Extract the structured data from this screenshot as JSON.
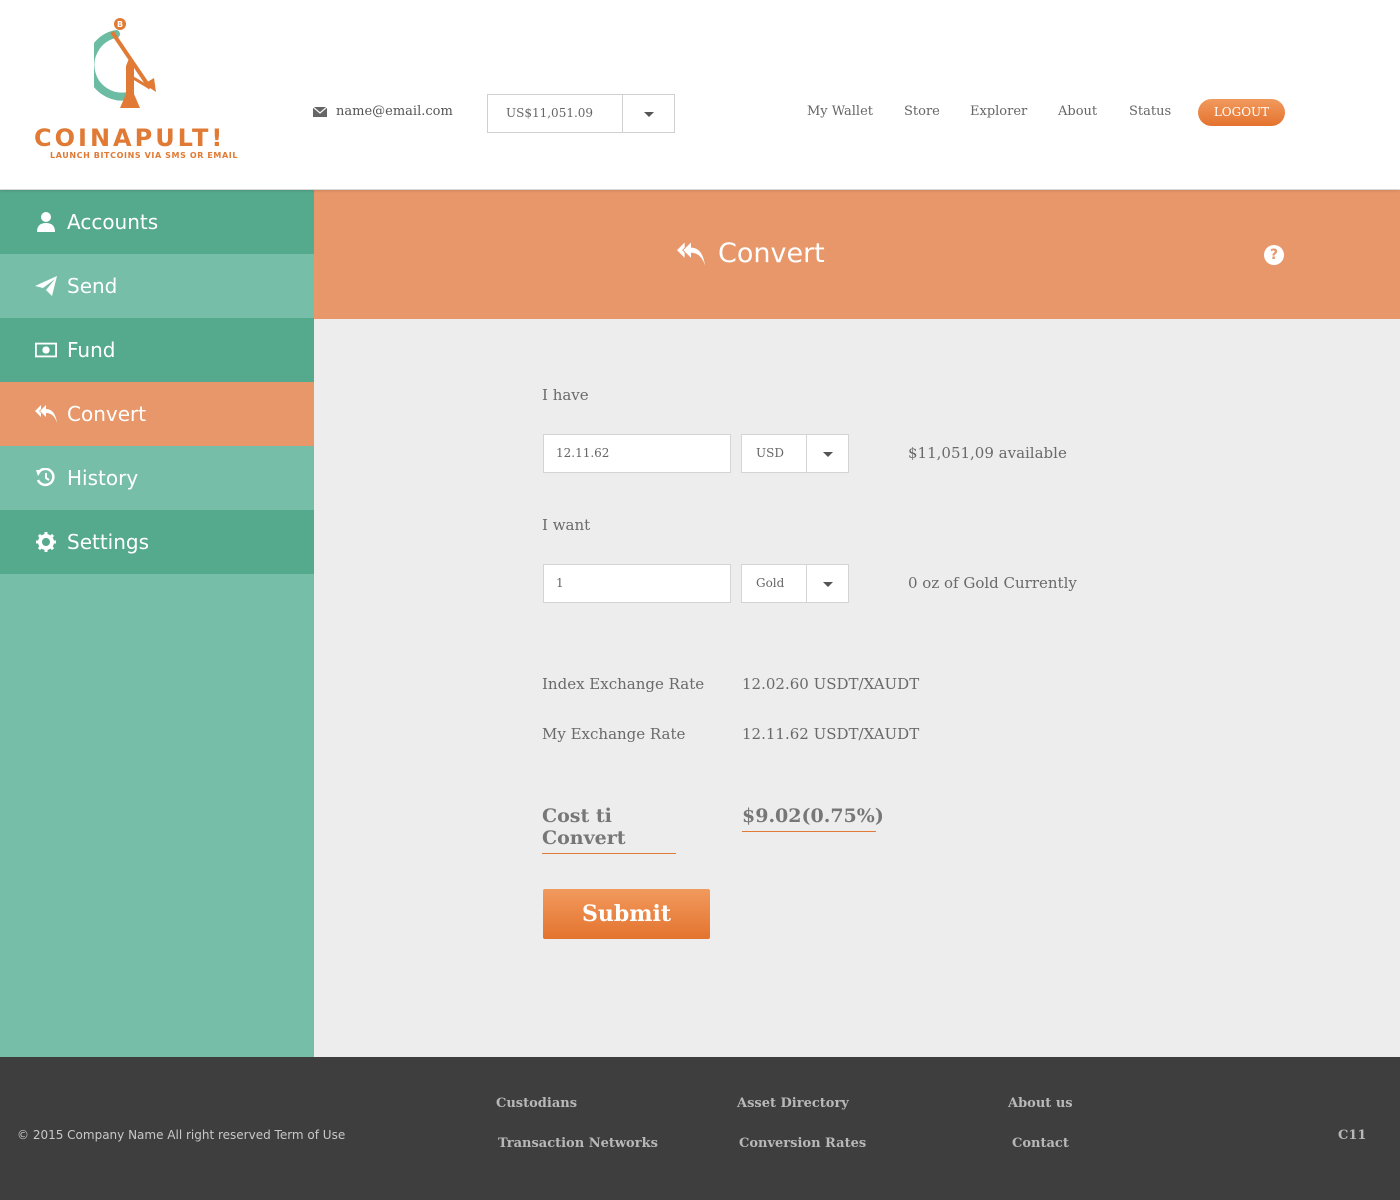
{
  "brand": {
    "name": "COINAPULT!",
    "tagline": "LAUNCH BITCOINS VIA SMS OR EMAIL",
    "accent": "#e07a35",
    "teal": "#6cbba3"
  },
  "header": {
    "email": "name@email.com",
    "balance": "US$11,051.09",
    "nav": [
      "My Wallet",
      "Store",
      "Explorer",
      "About",
      "Status"
    ],
    "logout": "LOGOUT"
  },
  "sidebar": {
    "items": [
      {
        "label": "Accounts",
        "icon": "user-icon"
      },
      {
        "label": "Send",
        "icon": "paper-plane-icon"
      },
      {
        "label": "Fund",
        "icon": "money-icon"
      },
      {
        "label": "Convert",
        "icon": "reply-all-icon",
        "active": true
      },
      {
        "label": "History",
        "icon": "history-icon"
      },
      {
        "label": "Settings",
        "icon": "gear-icon"
      }
    ]
  },
  "main": {
    "title": "Convert",
    "have": {
      "label": "I have",
      "amount": "12.11.62",
      "currency": "USD",
      "note": "$11,051,09 available"
    },
    "want": {
      "label": "I want",
      "amount": "1",
      "currency": "Gold",
      "note": "0 oz of Gold Currently"
    },
    "rates": [
      {
        "label": "Index Exchange Rate",
        "value": "12.02.60 USDT/XAUDT"
      },
      {
        "label": "My Exchange Rate",
        "value": "12.11.62 USDT/XAUDT"
      }
    ],
    "cost": {
      "label": "Cost ti Convert",
      "value": "$9.02(0.75%)"
    },
    "submit": "Submit"
  },
  "footer": {
    "copyright": "© 2015 Company Name  All right reserved  Term of Use",
    "links": [
      "Custodians",
      "Asset Directory",
      "About us",
      "Transaction Networks",
      "Conversion Rates",
      "Contact"
    ],
    "code": "C11"
  }
}
